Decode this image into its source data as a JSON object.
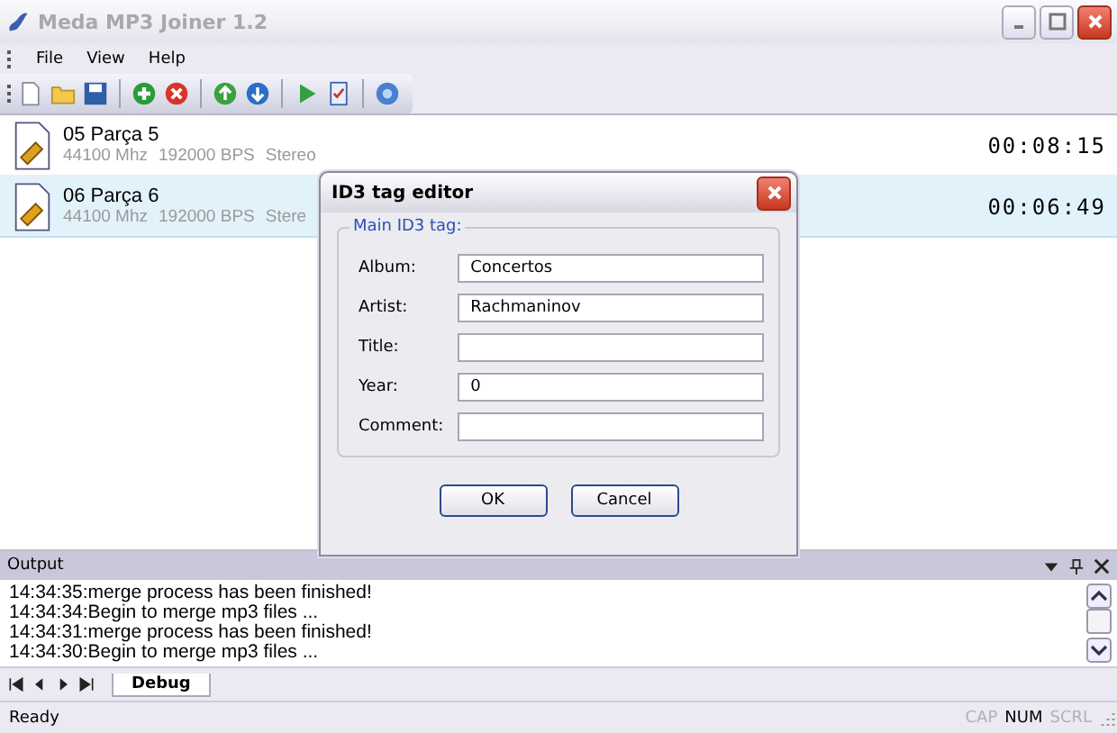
{
  "window": {
    "title": "Meda MP3 Joiner 1.2"
  },
  "menu": [
    "File",
    "View",
    "Help"
  ],
  "toolbar": [
    {
      "kind": "new"
    },
    {
      "kind": "open"
    },
    {
      "kind": "save"
    },
    {
      "kind": "add"
    },
    {
      "kind": "remove"
    },
    {
      "kind": "up"
    },
    {
      "kind": "down"
    },
    {
      "kind": "play"
    },
    {
      "kind": "check"
    },
    {
      "kind": "help"
    }
  ],
  "tracks": [
    {
      "name": "05 Parça 5",
      "rate": "44100 Mhz",
      "bitrate": "192000 BPS",
      "mode": "Stereo",
      "duration": "00:08:15",
      "selected": false
    },
    {
      "name": "06 Parça 6",
      "rate": "44100 Mhz",
      "bitrate": "192000 BPS",
      "mode": "Stere",
      "duration": "00:06:49",
      "selected": true
    }
  ],
  "dialog": {
    "title": "ID3 tag editor",
    "group": "Main ID3 tag:",
    "fields": [
      {
        "label": "Album:",
        "value": "Concertos"
      },
      {
        "label": "Artist:",
        "value": "Rachmaninov"
      },
      {
        "label": "Title:"
      },
      {
        "label": "Year:",
        "value": "0"
      },
      {
        "label": "Comment:"
      }
    ],
    "buttons": [
      "OK",
      "Cancel"
    ]
  },
  "output": {
    "title": "Output",
    "lines": [
      "14:34:35:merge process has been finished!",
      "14:34:34:Begin to merge mp3 files ...",
      "14:34:31:merge process has been finished!",
      "14:34:30:Begin to merge mp3 files ..."
    ],
    "tabs": [
      {
        "label": "Debug",
        "selected": true
      }
    ]
  },
  "status_bar": {
    "text": "Ready",
    "indicators": [
      {
        "label": "CAP",
        "on": false
      },
      {
        "label": "NUM",
        "on": true
      },
      {
        "label": "SCRL",
        "on": false
      }
    ]
  }
}
